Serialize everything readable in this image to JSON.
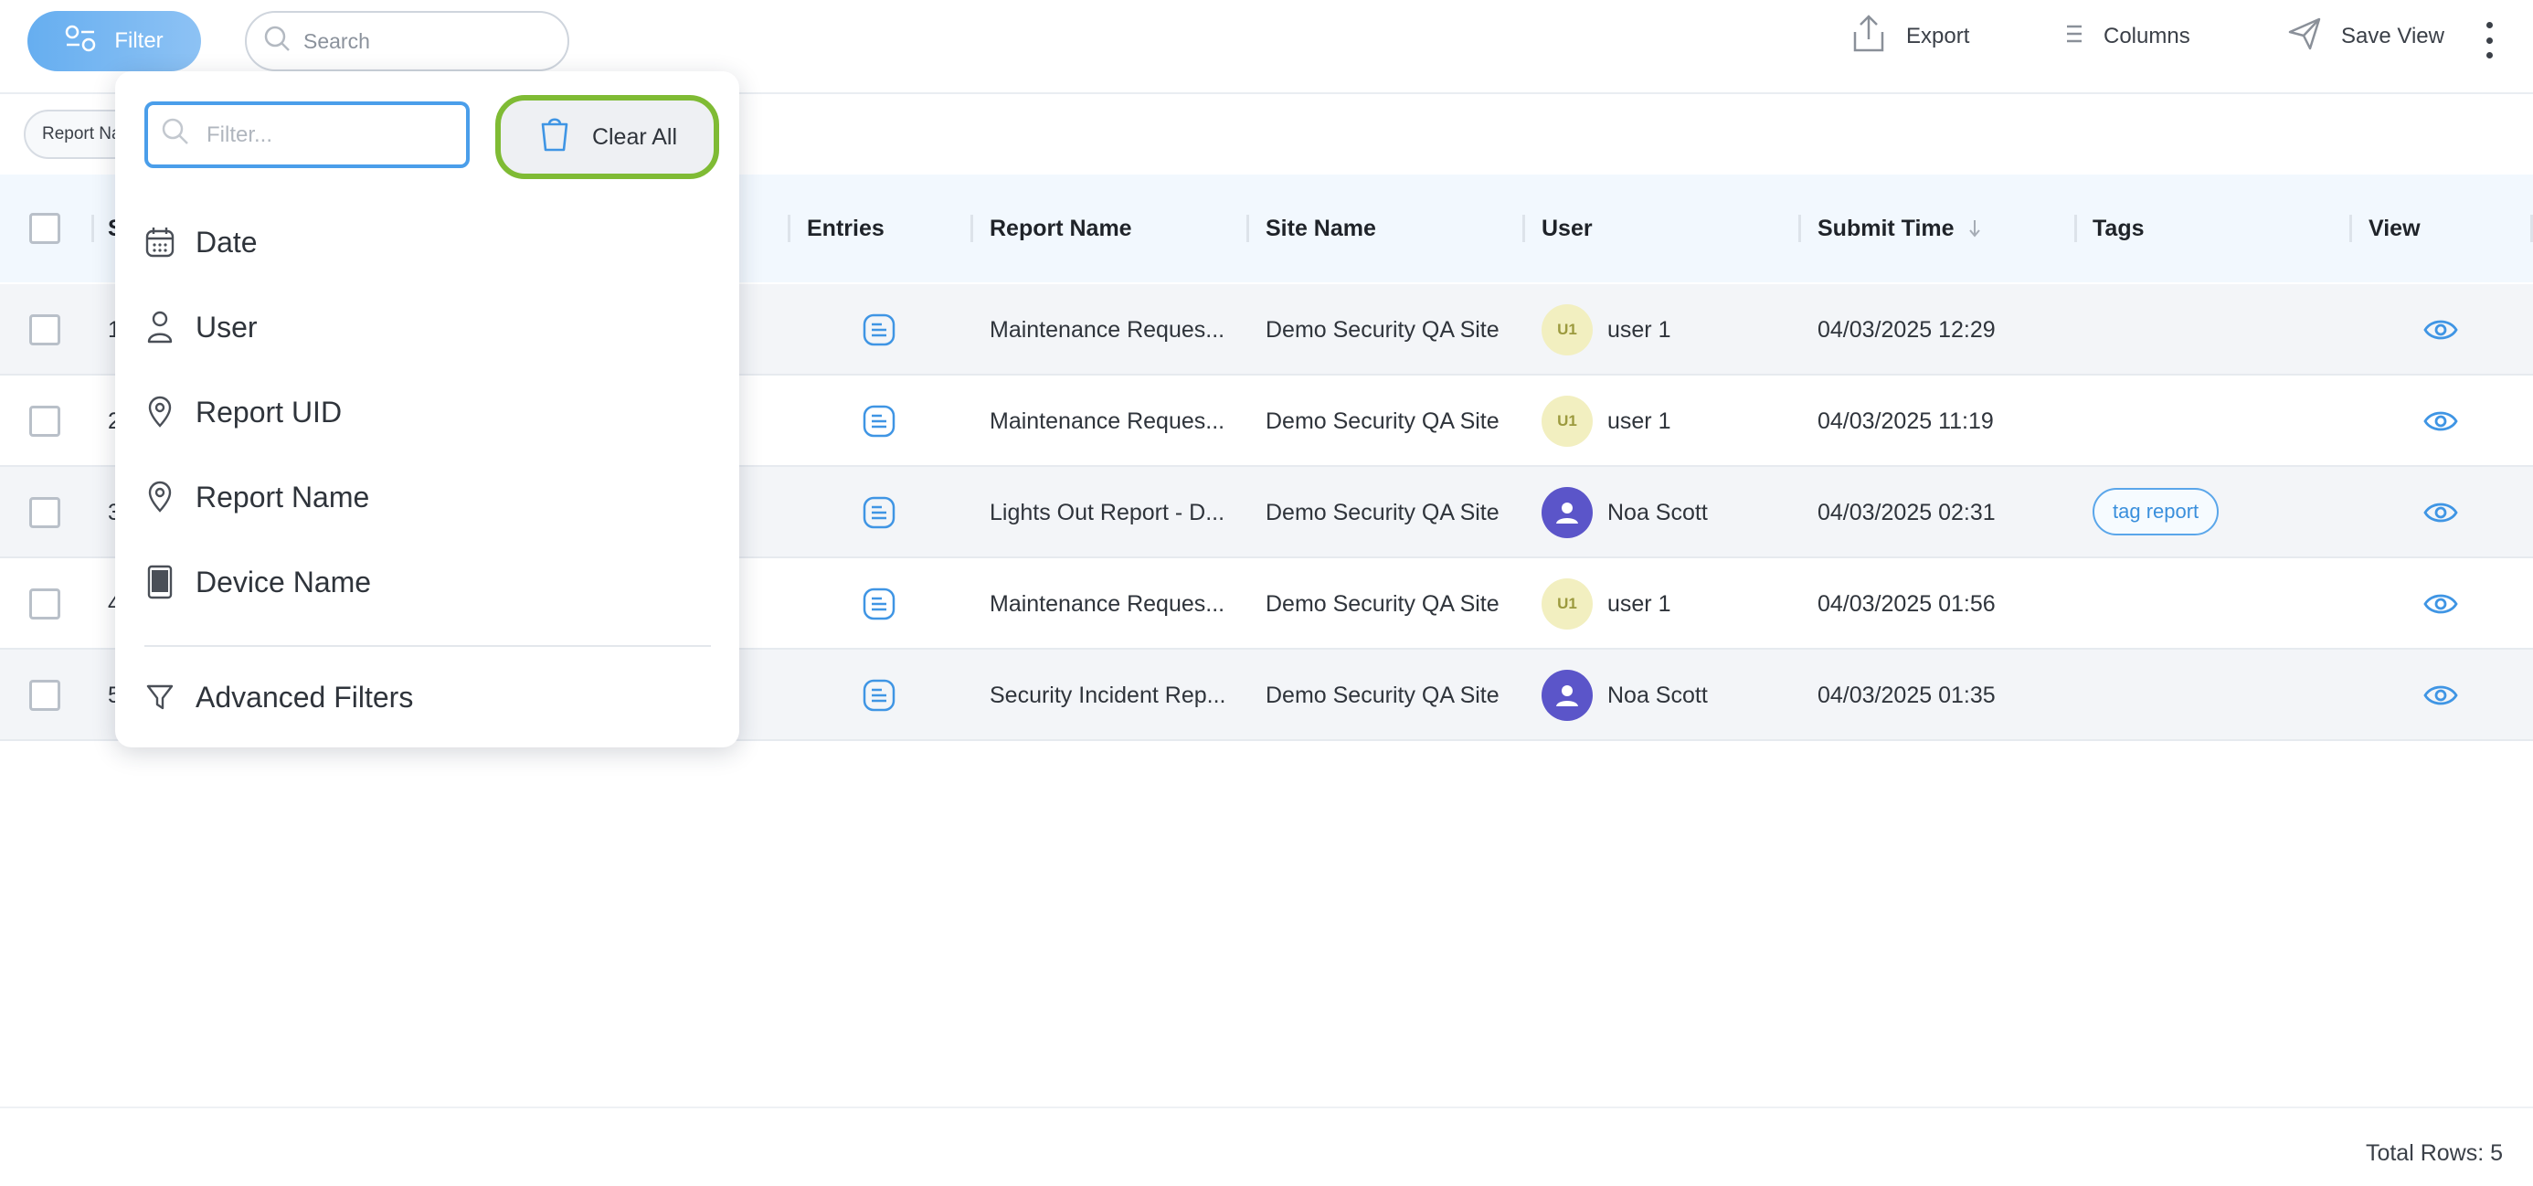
{
  "toolbar": {
    "filter_label": "Filter",
    "search_placeholder": "Search",
    "export_label": "Export",
    "columns_label": "Columns",
    "save_view_label": "Save View"
  },
  "chips": [
    {
      "label": "Report Name"
    }
  ],
  "table": {
    "columns": {
      "s": "S",
      "entries": "Entries",
      "report_name": "Report Name",
      "site_name": "Site Name",
      "user": "User",
      "submit_time": "Submit Time",
      "tags": "Tags",
      "view": "View"
    },
    "rows": [
      {
        "s": "1",
        "report_name": "Maintenance Reques...",
        "site_name": "Demo Security QA Site",
        "avatar_initials": "U1",
        "user": "user 1",
        "submit_time": "04/03/2025 12:29",
        "tag": ""
      },
      {
        "s": "2",
        "report_name": "Maintenance Reques...",
        "site_name": "Demo Security QA Site",
        "avatar_initials": "U1",
        "user": "user 1",
        "submit_time": "04/03/2025 11:19",
        "tag": ""
      },
      {
        "s": "3",
        "report_name": "Lights Out Report - D...",
        "site_name": "Demo Security QA Site",
        "avatar_initials": "",
        "user": "Noa Scott",
        "submit_time": "04/03/2025 02:31",
        "tag": "tag report"
      },
      {
        "s": "4",
        "report_name": "Maintenance Reques...",
        "site_name": "Demo Security QA Site",
        "avatar_initials": "U1",
        "user": "user 1",
        "submit_time": "04/03/2025 01:56",
        "tag": ""
      },
      {
        "s": "5",
        "report_name": "Security Incident Rep...",
        "site_name": "Demo Security QA Site",
        "avatar_initials": "",
        "user": "Noa Scott",
        "submit_time": "04/03/2025 01:35",
        "tag": ""
      }
    ]
  },
  "footer": {
    "total_rows": "Total Rows: 5"
  },
  "filter_menu": {
    "input_placeholder": "Filter...",
    "clear_all_label": "Clear All",
    "items": [
      {
        "label": "Date",
        "icon": "calendar-icon"
      },
      {
        "label": "User",
        "icon": "user-icon"
      },
      {
        "label": "Report UID",
        "icon": "location-pin-icon"
      },
      {
        "label": "Report Name",
        "icon": "location-pin-icon"
      },
      {
        "label": "Device Name",
        "icon": "tablet-icon"
      }
    ],
    "advanced_label": "Advanced Filters"
  },
  "colors": {
    "accent": "#4a9eea",
    "highlight": "#7fbb34",
    "avatar_initials_bg": "#f2efc0",
    "avatar_photo_bg": "#5b55c9"
  }
}
